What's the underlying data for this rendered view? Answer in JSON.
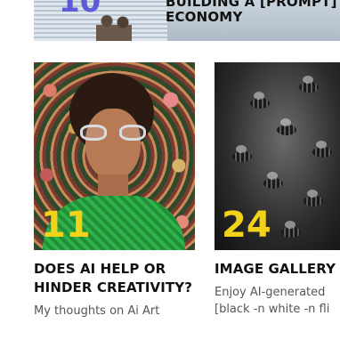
{
  "banner": {
    "number": "10",
    "title": "BUILDING A [PROMPT] ECONOMY"
  },
  "cards": [
    {
      "number": "11",
      "title": "DOES AI HELP OR HINDER CREATIVITY?",
      "description": "My thoughts on Ai Art"
    },
    {
      "number": "24",
      "title": "IMAGE GALLERY",
      "description_line1": "Enjoy AI-generated",
      "description_line2": "[black -n white -n fli"
    }
  ],
  "colors": {
    "number_accent": "#f2d31a",
    "banner_number": "#5d5bd8",
    "title_text": "#111111",
    "desc_text": "#555555"
  }
}
